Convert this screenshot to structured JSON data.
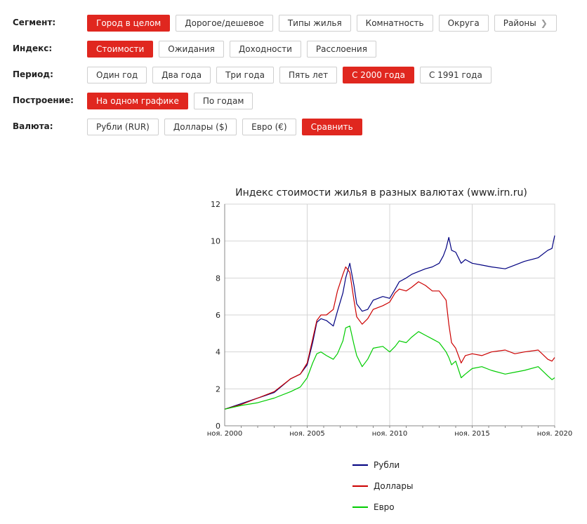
{
  "filters": [
    {
      "label": "Сегмент:",
      "options": [
        {
          "label": "Город в целом",
          "active": true
        },
        {
          "label": "Дорогое/дешевое"
        },
        {
          "label": "Типы жилья"
        },
        {
          "label": "Комнатность"
        },
        {
          "label": "Округа"
        },
        {
          "label": "Районы",
          "chevron": true
        }
      ]
    },
    {
      "label": "Индекс:",
      "options": [
        {
          "label": "Стоимости",
          "active": true
        },
        {
          "label": "Ожидания"
        },
        {
          "label": "Доходности"
        },
        {
          "label": "Расслоения"
        }
      ]
    },
    {
      "label": "Период:",
      "options": [
        {
          "label": "Один год"
        },
        {
          "label": "Два года"
        },
        {
          "label": "Три года"
        },
        {
          "label": "Пять лет"
        },
        {
          "label": "С 2000 года",
          "active": true
        },
        {
          "label": "С 1991 года"
        }
      ]
    },
    {
      "label": "Построение:",
      "options": [
        {
          "label": "На одном графике",
          "active": true
        },
        {
          "label": "По годам"
        }
      ]
    },
    {
      "label": "Валюта:",
      "options": [
        {
          "label": "Рубли (RUR)"
        },
        {
          "label": "Доллары ($)"
        },
        {
          "label": "Евро (€)"
        },
        {
          "label": "Сравнить",
          "active": true
        }
      ]
    }
  ],
  "colors": {
    "accent": "#e0271f"
  },
  "chart_data": {
    "type": "line",
    "title": "Индекс стоимости жилья в разных валютах (www.irn.ru)",
    "xlabel": "",
    "ylabel": "",
    "xlim": [
      "2000-11",
      "2020-11"
    ],
    "ylim": [
      0,
      12
    ],
    "yticks": [
      0,
      2,
      4,
      6,
      8,
      10,
      12
    ],
    "xticks": [
      {
        "x": "2000-11",
        "label": "ноя. 2000"
      },
      {
        "x": "2005-11",
        "label": "ноя. 2005"
      },
      {
        "x": "2010-11",
        "label": "ноя. 2010"
      },
      {
        "x": "2015-11",
        "label": "ноя. 2015"
      },
      {
        "x": "2020-11",
        "label": "ноя. 2020"
      }
    ],
    "grid": true,
    "legend": "bottom",
    "series": [
      {
        "name": "Рубли",
        "color": "#000080",
        "points": [
          [
            "2000-11",
            0.9
          ],
          [
            "2001-11",
            1.2
          ],
          [
            "2002-11",
            1.5
          ],
          [
            "2003-11",
            1.8
          ],
          [
            "2004-11",
            2.55
          ],
          [
            "2005-06",
            2.8
          ],
          [
            "2005-11",
            3.3
          ],
          [
            "2006-03",
            4.5
          ],
          [
            "2006-06",
            5.6
          ],
          [
            "2006-09",
            5.8
          ],
          [
            "2007-01",
            5.7
          ],
          [
            "2007-06",
            5.4
          ],
          [
            "2007-09",
            6.2
          ],
          [
            "2008-01",
            7.2
          ],
          [
            "2008-03",
            8.0
          ],
          [
            "2008-06",
            8.8
          ],
          [
            "2008-09",
            7.6
          ],
          [
            "2008-11",
            6.6
          ],
          [
            "2009-03",
            6.2
          ],
          [
            "2009-07",
            6.3
          ],
          [
            "2009-11",
            6.8
          ],
          [
            "2010-06",
            7.0
          ],
          [
            "2010-11",
            6.9
          ],
          [
            "2011-03",
            7.4
          ],
          [
            "2011-06",
            7.8
          ],
          [
            "2011-11",
            8.0
          ],
          [
            "2012-03",
            8.2
          ],
          [
            "2012-08",
            8.35
          ],
          [
            "2013-01",
            8.5
          ],
          [
            "2013-06",
            8.6
          ],
          [
            "2013-11",
            8.8
          ],
          [
            "2014-02",
            9.2
          ],
          [
            "2014-04",
            9.6
          ],
          [
            "2014-06",
            10.2
          ],
          [
            "2014-08",
            9.5
          ],
          [
            "2014-11",
            9.4
          ],
          [
            "2015-03",
            8.8
          ],
          [
            "2015-06",
            9.0
          ],
          [
            "2015-11",
            8.8
          ],
          [
            "2016-06",
            8.7
          ],
          [
            "2017-01",
            8.6
          ],
          [
            "2017-11",
            8.5
          ],
          [
            "2018-06",
            8.7
          ],
          [
            "2019-01",
            8.9
          ],
          [
            "2019-11",
            9.1
          ],
          [
            "2020-06",
            9.5
          ],
          [
            "2020-09",
            9.6
          ],
          [
            "2020-11",
            10.3
          ]
        ]
      },
      {
        "name": "Доллары",
        "color": "#cc0000",
        "points": [
          [
            "2000-11",
            0.9
          ],
          [
            "2001-11",
            1.15
          ],
          [
            "2002-11",
            1.5
          ],
          [
            "2003-11",
            1.85
          ],
          [
            "2004-11",
            2.55
          ],
          [
            "2005-06",
            2.8
          ],
          [
            "2005-11",
            3.4
          ],
          [
            "2006-03",
            4.7
          ],
          [
            "2006-06",
            5.7
          ],
          [
            "2006-09",
            6.0
          ],
          [
            "2007-01",
            6.0
          ],
          [
            "2007-06",
            6.3
          ],
          [
            "2007-09",
            7.3
          ],
          [
            "2008-01",
            8.2
          ],
          [
            "2008-03",
            8.6
          ],
          [
            "2008-06",
            8.3
          ],
          [
            "2008-09",
            6.8
          ],
          [
            "2008-11",
            5.9
          ],
          [
            "2009-03",
            5.5
          ],
          [
            "2009-07",
            5.8
          ],
          [
            "2009-11",
            6.3
          ],
          [
            "2010-06",
            6.5
          ],
          [
            "2010-11",
            6.7
          ],
          [
            "2011-03",
            7.2
          ],
          [
            "2011-06",
            7.4
          ],
          [
            "2011-11",
            7.3
          ],
          [
            "2012-03",
            7.5
          ],
          [
            "2012-08",
            7.8
          ],
          [
            "2013-01",
            7.6
          ],
          [
            "2013-06",
            7.3
          ],
          [
            "2013-11",
            7.3
          ],
          [
            "2014-02",
            7.0
          ],
          [
            "2014-04",
            6.8
          ],
          [
            "2014-06",
            5.5
          ],
          [
            "2014-08",
            4.5
          ],
          [
            "2014-11",
            4.2
          ],
          [
            "2015-03",
            3.4
          ],
          [
            "2015-06",
            3.8
          ],
          [
            "2015-11",
            3.9
          ],
          [
            "2016-06",
            3.8
          ],
          [
            "2017-01",
            4.0
          ],
          [
            "2017-11",
            4.1
          ],
          [
            "2018-06",
            3.9
          ],
          [
            "2019-01",
            4.0
          ],
          [
            "2019-11",
            4.1
          ],
          [
            "2020-06",
            3.6
          ],
          [
            "2020-09",
            3.5
          ],
          [
            "2020-11",
            3.7
          ]
        ]
      },
      {
        "name": "Евро",
        "color": "#00cc00",
        "points": [
          [
            "2000-11",
            0.9
          ],
          [
            "2001-11",
            1.1
          ],
          [
            "2002-11",
            1.25
          ],
          [
            "2003-11",
            1.5
          ],
          [
            "2004-11",
            1.85
          ],
          [
            "2005-06",
            2.1
          ],
          [
            "2005-11",
            2.6
          ],
          [
            "2006-03",
            3.4
          ],
          [
            "2006-06",
            3.9
          ],
          [
            "2006-09",
            4.0
          ],
          [
            "2007-01",
            3.8
          ],
          [
            "2007-06",
            3.6
          ],
          [
            "2007-09",
            3.9
          ],
          [
            "2008-01",
            4.6
          ],
          [
            "2008-03",
            5.3
          ],
          [
            "2008-06",
            5.4
          ],
          [
            "2008-09",
            4.4
          ],
          [
            "2008-11",
            3.8
          ],
          [
            "2009-03",
            3.2
          ],
          [
            "2009-07",
            3.6
          ],
          [
            "2009-11",
            4.2
          ],
          [
            "2010-06",
            4.3
          ],
          [
            "2010-11",
            4.0
          ],
          [
            "2011-03",
            4.3
          ],
          [
            "2011-06",
            4.6
          ],
          [
            "2011-11",
            4.5
          ],
          [
            "2012-03",
            4.8
          ],
          [
            "2012-08",
            5.1
          ],
          [
            "2013-01",
            4.9
          ],
          [
            "2013-06",
            4.7
          ],
          [
            "2013-11",
            4.5
          ],
          [
            "2014-02",
            4.2
          ],
          [
            "2014-04",
            4.0
          ],
          [
            "2014-06",
            3.7
          ],
          [
            "2014-08",
            3.3
          ],
          [
            "2014-11",
            3.5
          ],
          [
            "2015-03",
            2.6
          ],
          [
            "2015-06",
            2.8
          ],
          [
            "2015-11",
            3.1
          ],
          [
            "2016-06",
            3.2
          ],
          [
            "2017-01",
            3.0
          ],
          [
            "2017-11",
            2.8
          ],
          [
            "2018-06",
            2.9
          ],
          [
            "2019-01",
            3.0
          ],
          [
            "2019-11",
            3.2
          ],
          [
            "2020-06",
            2.7
          ],
          [
            "2020-09",
            2.5
          ],
          [
            "2020-11",
            2.6
          ]
        ]
      }
    ]
  }
}
